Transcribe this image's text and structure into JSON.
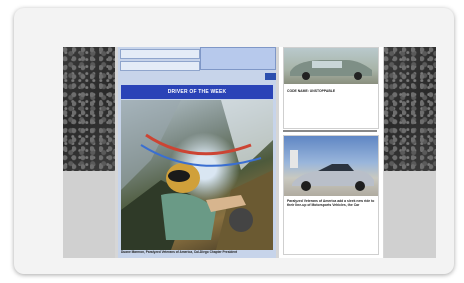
{
  "sidebar": {
    "field1_value": "",
    "field2_value": ""
  },
  "feature": {
    "heading": "DRIVER OF THE WEEK",
    "caption": "Duane Marmon, Paralyzed Veterans of America, Cal-Diego Chapter President"
  },
  "right": {
    "card1": {
      "title": "CODE NAME: UNSTOPPABLE",
      "body": ""
    },
    "card2": {
      "title": "Paralyzed Veterans of America add a sleek new ride to their line-up of Motorsports Vehicles, the Car",
      "body": ""
    }
  },
  "colors": {
    "heading_bar": "#2a43b7",
    "sidebar_bg": "#c7d4ea",
    "car2_body": "#b9bfc9"
  }
}
